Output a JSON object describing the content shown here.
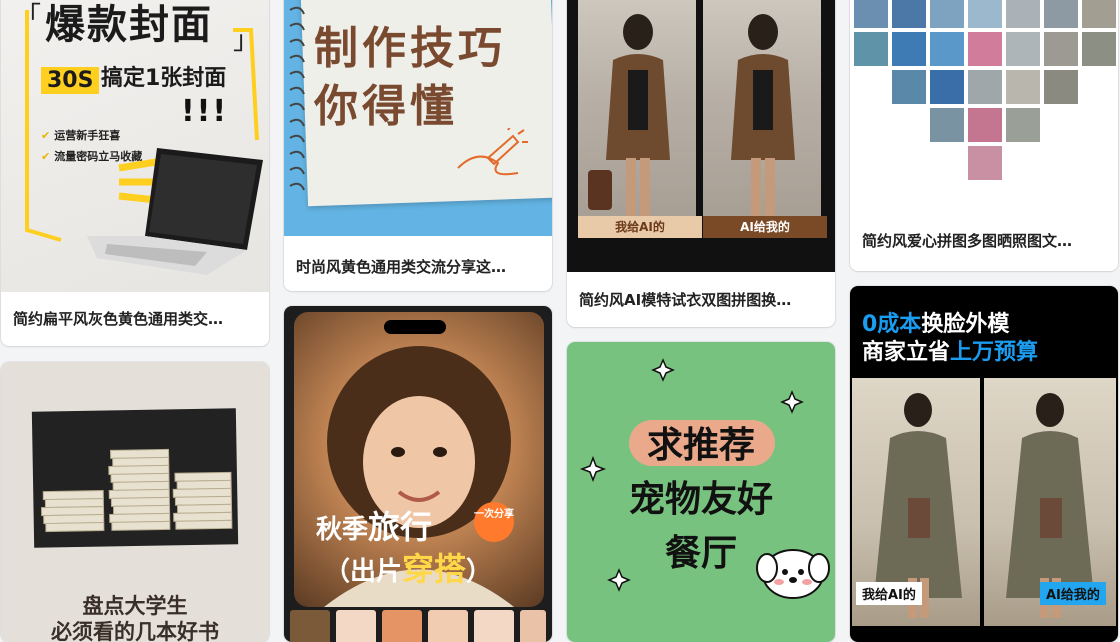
{
  "colors": {
    "page_bg": "#f3f4f6",
    "card_bg": "#ffffff",
    "yellow_accent": "#ffcf1f",
    "brown_text": "#7a4a30",
    "blue_accent": "#1a9df0",
    "green_bg": "#78c27f"
  },
  "cards": [
    {
      "title": "简约扁平风灰色黄色通用类交…",
      "cover": {
        "bracket_left": "「",
        "bracket_right": "」",
        "headline": "爆款封面",
        "badge": "30S",
        "subtitle": "搞定1张封面",
        "exclaim": "!!!",
        "bullets": [
          "运营新手狂喜",
          "流量密码立马收藏"
        ]
      }
    },
    {
      "title": "时尚风黄色通用类交流分享这…",
      "cover": {
        "lines": [
          "制作技巧",
          "你得懂"
        ]
      }
    },
    {
      "title": "简约风AI模特试衣双图拼图换…",
      "cover": {
        "label_left": "我给AI的",
        "label_right": "AI给我的"
      }
    },
    {
      "title": "简约风爱心拼图多图晒照图文…"
    },
    {
      "cover": {
        "line1": "盘点大学生",
        "line2": "必须看的几本好书"
      }
    },
    {
      "cover": {
        "text1": "秋季",
        "text2": "旅行",
        "text3": "（出片",
        "text4": "穿搭",
        "text5": "）",
        "badge": "一次分享"
      }
    },
    {
      "cover": {
        "line1": "求推荐",
        "line2": "宠物友好",
        "line3": "餐厅"
      }
    },
    {
      "cover": {
        "line1_accent": "0成本",
        "line1_rest": "换脸外模",
        "line2_rest": "商家立省",
        "line2_accent": "上万预算",
        "label_left": "我给AI的",
        "label_right": "AI给我的"
      }
    }
  ]
}
